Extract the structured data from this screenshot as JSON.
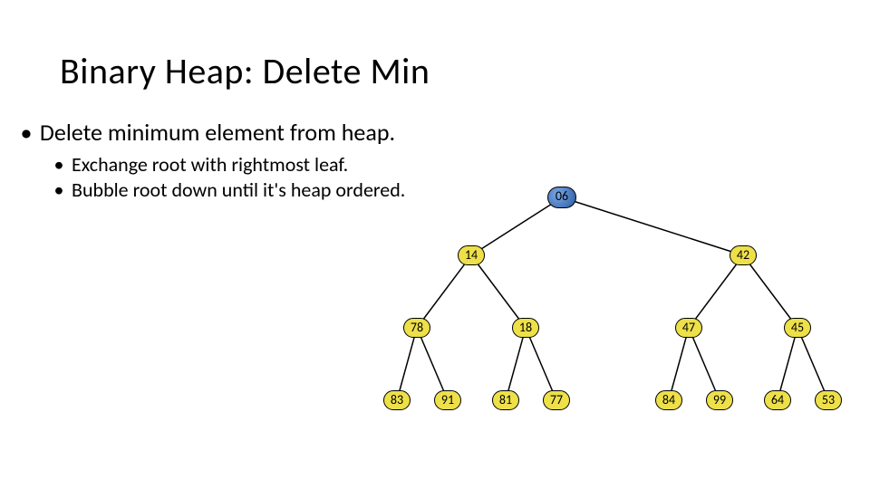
{
  "title": "Binary Heap:  Delete Min",
  "bullet1": "Delete minimum element from heap.",
  "bullet2a": "Exchange root with rightmost leaf.",
  "bullet2b": "Bubble root down until it's heap ordered.",
  "tree": {
    "root": "06",
    "level2": [
      "14",
      "42"
    ],
    "level3": [
      "78",
      "18",
      "47",
      "45"
    ],
    "level4": [
      "83",
      "91",
      "81",
      "77",
      "84",
      "99",
      "64",
      "53"
    ]
  },
  "chart_data": {
    "type": "tree",
    "description": "Binary min-heap before delete-min, root highlighted",
    "nodes": [
      {
        "id": 1,
        "value": 6,
        "parent": null,
        "highlight": true
      },
      {
        "id": 2,
        "value": 14,
        "parent": 1
      },
      {
        "id": 3,
        "value": 42,
        "parent": 1
      },
      {
        "id": 4,
        "value": 78,
        "parent": 2
      },
      {
        "id": 5,
        "value": 18,
        "parent": 2
      },
      {
        "id": 6,
        "value": 47,
        "parent": 3
      },
      {
        "id": 7,
        "value": 45,
        "parent": 3
      },
      {
        "id": 8,
        "value": 83,
        "parent": 4
      },
      {
        "id": 9,
        "value": 91,
        "parent": 4
      },
      {
        "id": 10,
        "value": 81,
        "parent": 5
      },
      {
        "id": 11,
        "value": 77,
        "parent": 5
      },
      {
        "id": 12,
        "value": 84,
        "parent": 6
      },
      {
        "id": 13,
        "value": 99,
        "parent": 6
      },
      {
        "id": 14,
        "value": 64,
        "parent": 7
      },
      {
        "id": 15,
        "value": 53,
        "parent": 7
      }
    ]
  }
}
